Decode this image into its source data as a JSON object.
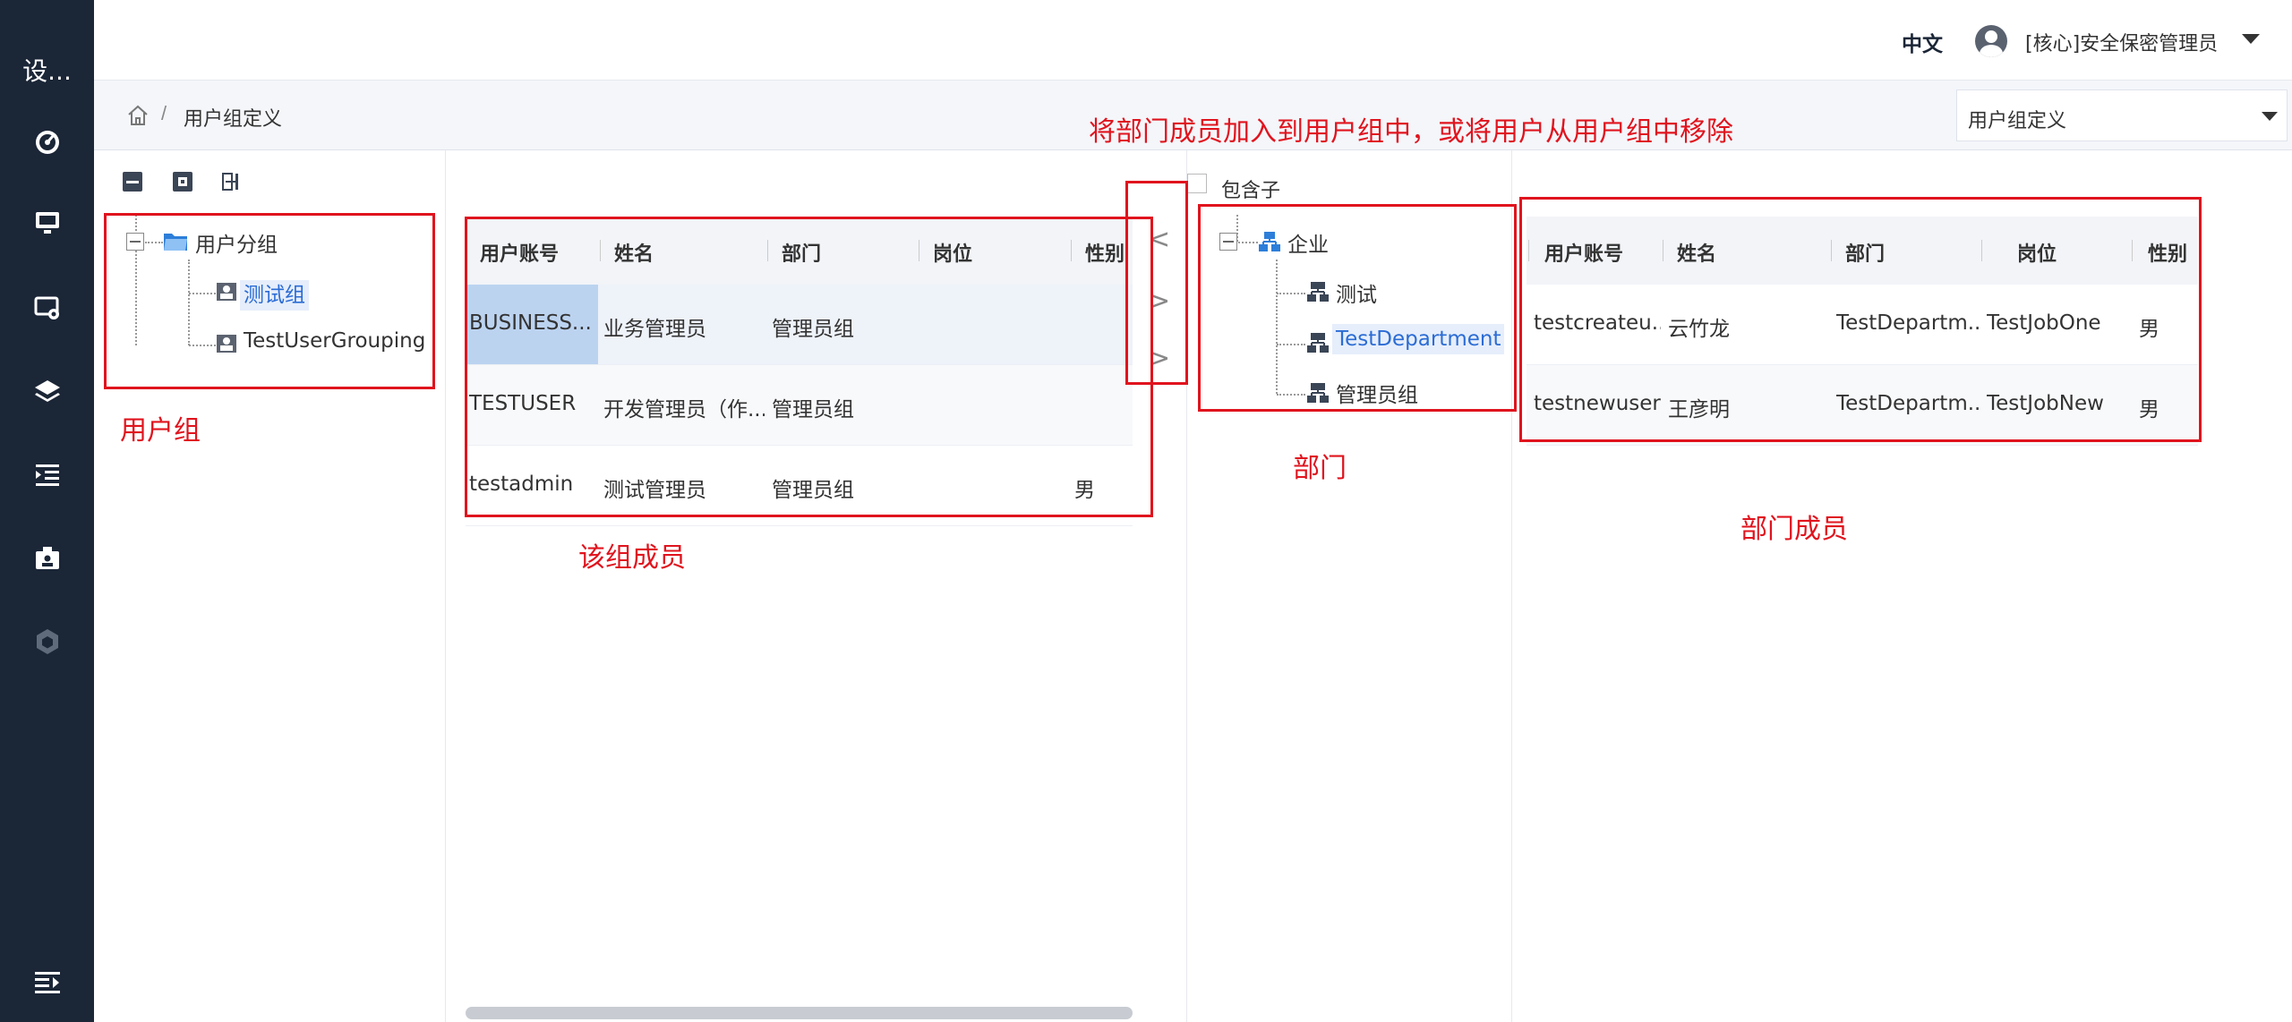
{
  "sidebar": {
    "brand": "设...",
    "icons": [
      "dashboard-icon",
      "monitor-icon",
      "settings-screen-icon",
      "layers-icon",
      "indent-list-icon",
      "id-badge-icon",
      "shield-cube-icon"
    ],
    "collapse_icon": "menu-collapse-icon"
  },
  "header": {
    "language": "中文",
    "user": "[核心]安全保密管理员"
  },
  "breadcrumb": {
    "separator": "/",
    "current": "用户组定义",
    "select_value": "用户组定义"
  },
  "toolbar": {
    "icons": [
      "collapse-all-icon",
      "expand-all-icon",
      "split-view-icon"
    ]
  },
  "group_tree": {
    "root": "用户分组",
    "children": [
      "测试组",
      "TestUserGrouping"
    ],
    "selected": "测试组"
  },
  "group_members": {
    "columns": [
      "用户账号",
      "姓名",
      "部门",
      "岗位",
      "性别"
    ],
    "rows": [
      {
        "account": "BUSINESS...",
        "name": "业务管理员",
        "dept": "管理员组",
        "job": "",
        "gender": ""
      },
      {
        "account": "TESTUSER",
        "name": "开发管理员（作...",
        "dept": "管理员组",
        "job": "",
        "gender": ""
      },
      {
        "account": "testadmin",
        "name": "测试管理员",
        "dept": "管理员组",
        "job": "",
        "gender": "男"
      }
    ]
  },
  "transfer": {
    "left": "<",
    "right1": ">",
    "right2": ">"
  },
  "include_children": "包含子",
  "dept_tree": {
    "root": "企业",
    "children": [
      "测试",
      "TestDepartment",
      "管理员组"
    ],
    "selected": "TestDepartment"
  },
  "dept_members": {
    "columns": [
      "用户账号",
      "姓名",
      "部门",
      "岗位",
      "性别"
    ],
    "rows": [
      {
        "account": "testcreateu...",
        "name": "云竹龙",
        "dept": "TestDepartm...",
        "job": "TestJobOne",
        "gender": "男"
      },
      {
        "account": "testnewuser",
        "name": "王彦明",
        "dept": "TestDepartm...",
        "job": "TestJobNew",
        "gender": "男"
      }
    ]
  },
  "annotations": {
    "title": "将部门成员加入到用户组中，或将用户从用户组中移除",
    "user_group": "用户组",
    "group_members": "该组成员",
    "department": "部门",
    "dept_members": "部门成员"
  },
  "colors": {
    "sidebar_bg": "#1b2637",
    "annotation_red": "#e0141e",
    "selection_blue": "#2b6cd4"
  }
}
